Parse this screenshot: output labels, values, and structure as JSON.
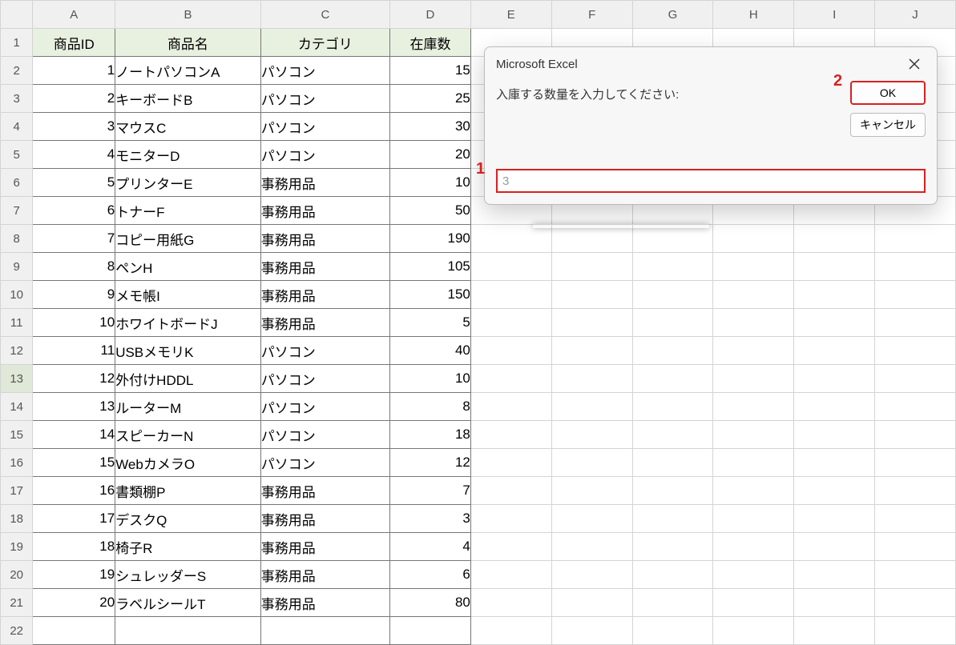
{
  "columns": [
    "A",
    "B",
    "C",
    "D",
    "E",
    "F",
    "G",
    "H",
    "I",
    "J"
  ],
  "row_numbers": [
    1,
    2,
    3,
    4,
    5,
    6,
    7,
    8,
    9,
    10,
    11,
    12,
    13,
    14,
    15,
    16,
    17,
    18,
    19,
    20,
    21,
    22
  ],
  "headers": {
    "A": "商品ID",
    "B": "商品名",
    "C": "カテゴリ",
    "D": "在庫数"
  },
  "rows": [
    {
      "id": 1,
      "name": "ノートパソコンA",
      "cat": "パソコン",
      "stock": 15
    },
    {
      "id": 2,
      "name": "キーボードB",
      "cat": "パソコン",
      "stock": 25
    },
    {
      "id": 3,
      "name": "マウスC",
      "cat": "パソコン",
      "stock": 30
    },
    {
      "id": 4,
      "name": "モニターD",
      "cat": "パソコン",
      "stock": 20
    },
    {
      "id": 5,
      "name": "プリンターE",
      "cat": "事務用品",
      "stock": 10
    },
    {
      "id": 6,
      "name": "トナーF",
      "cat": "事務用品",
      "stock": 50
    },
    {
      "id": 7,
      "name": "コピー用紙G",
      "cat": "事務用品",
      "stock": 190
    },
    {
      "id": 8,
      "name": "ペンH",
      "cat": "事務用品",
      "stock": 105
    },
    {
      "id": 9,
      "name": "メモ帳I",
      "cat": "事務用品",
      "stock": 150
    },
    {
      "id": 10,
      "name": "ホワイトボードJ",
      "cat": "事務用品",
      "stock": 5
    },
    {
      "id": 11,
      "name": "USBメモリK",
      "cat": "パソコン",
      "stock": 40
    },
    {
      "id": 12,
      "name": "外付けHDDL",
      "cat": "パソコン",
      "stock": 10
    },
    {
      "id": 13,
      "name": "ルーターM",
      "cat": "パソコン",
      "stock": 8
    },
    {
      "id": 14,
      "name": "スピーカーN",
      "cat": "パソコン",
      "stock": 18
    },
    {
      "id": 15,
      "name": "WebカメラO",
      "cat": "パソコン",
      "stock": 12
    },
    {
      "id": 16,
      "name": "書類棚P",
      "cat": "事務用品",
      "stock": 7
    },
    {
      "id": 17,
      "name": "デスクQ",
      "cat": "事務用品",
      "stock": 3
    },
    {
      "id": 18,
      "name": "椅子R",
      "cat": "事務用品",
      "stock": 4
    },
    {
      "id": 19,
      "name": "シュレッダーS",
      "cat": "事務用品",
      "stock": 6
    },
    {
      "id": 20,
      "name": "ラベルシールT",
      "cat": "事務用品",
      "stock": 80
    }
  ],
  "selected_row_header": 13,
  "dialog": {
    "title": "Microsoft Excel",
    "prompt": "入庫する数量を入力してください:",
    "ok_label": "OK",
    "cancel_label": "キャンセル",
    "input_value": "3"
  },
  "annotations": {
    "one": "1",
    "two": "2"
  }
}
